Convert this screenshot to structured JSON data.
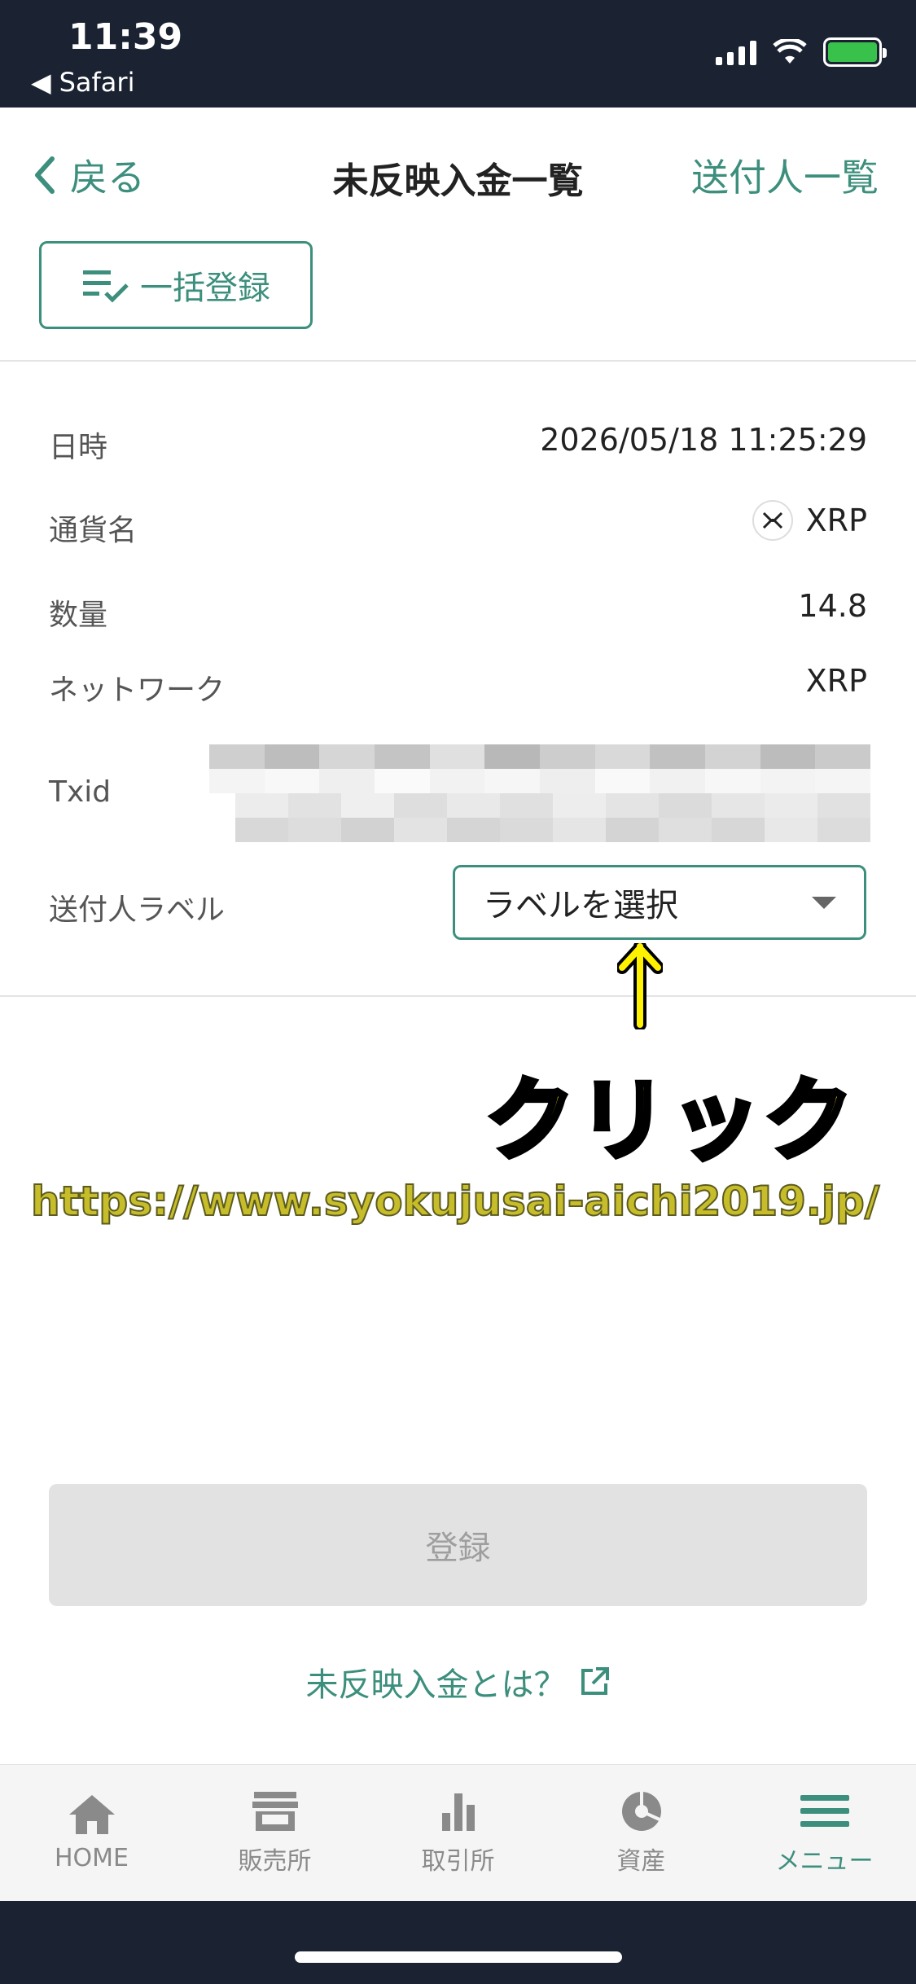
{
  "status": {
    "time": "11:39",
    "back_app": "Safari"
  },
  "nav": {
    "back_label": "戻る",
    "title": "未反映入金一覧",
    "right_label": "送付人一覧"
  },
  "bulk_button": "一括登録",
  "details": {
    "datetime_label": "日時",
    "datetime_value": "2026/05/18 11:25:29",
    "currency_label": "通貨名",
    "currency_value": "XRP",
    "amount_label": "数量",
    "amount_value": "14.8",
    "network_label": "ネットワーク",
    "network_value": "XRP",
    "txid_label": "Txid",
    "sender_label": "送付人ラベル"
  },
  "select": {
    "placeholder": "ラベルを選択"
  },
  "annotation": {
    "click_text": "クリック",
    "watermark": "https://www.syokujusai-aichi2019.jp/"
  },
  "submit_label": "登録",
  "help_link": "未反映入金とは？",
  "tabs": [
    {
      "label": "HOME",
      "icon": "home-icon"
    },
    {
      "label": "販売所",
      "icon": "store-icon"
    },
    {
      "label": "取引所",
      "icon": "bar-chart-icon"
    },
    {
      "label": "資産",
      "icon": "pie-chart-icon"
    },
    {
      "label": "メニュー",
      "icon": "menu-icon"
    }
  ],
  "colors": {
    "accent": "#3d8f7d",
    "status_bar": "#1b2333",
    "highlight": "#fff200"
  }
}
